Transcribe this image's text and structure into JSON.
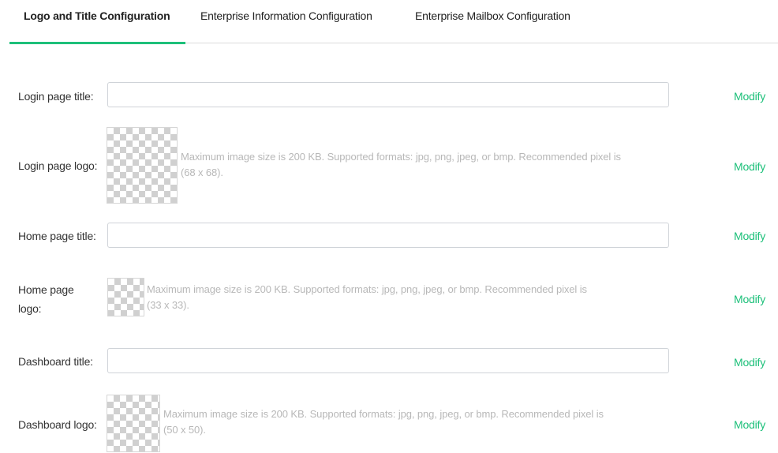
{
  "tabs": [
    {
      "label": "Logo and Title Configuration",
      "active": true
    },
    {
      "label": "Enterprise Information Configuration",
      "active": false
    },
    {
      "label": "Enterprise Mailbox Configuration",
      "active": false
    }
  ],
  "accent_color": "#1dc07a",
  "rows": {
    "login_title": {
      "label": "Login page title:",
      "value": "",
      "action": "Modify"
    },
    "login_logo": {
      "label": "Login page logo:",
      "hint_line1": "Maximum image size is 200 KB. Supported formats: jpg, png, jpeg, or bmp. Recommended pixel is",
      "hint_line2": "(68 x 68).",
      "action": "Modify"
    },
    "home_title": {
      "label": "Home page title:",
      "value": "",
      "action": "Modify"
    },
    "home_logo": {
      "label_line1": "Home page",
      "label_line2": "logo:",
      "hint_line1": "Maximum image size is 200 KB. Supported formats: jpg, png, jpeg, or bmp. Recommended pixel is",
      "hint_line2": "(33 x 33).",
      "action": "Modify"
    },
    "dashboard_title": {
      "label": "Dashboard title:",
      "value": "",
      "action": "Modify"
    },
    "dashboard_logo": {
      "label": "Dashboard logo:",
      "hint_line1": "Maximum image size is 200 KB. Supported formats: jpg, png, jpeg, or bmp. Recommended pixel is",
      "hint_line2": "(50 x 50).",
      "action": "Modify"
    }
  },
  "logo_placeholder_icon": "transparent-checkerboard"
}
